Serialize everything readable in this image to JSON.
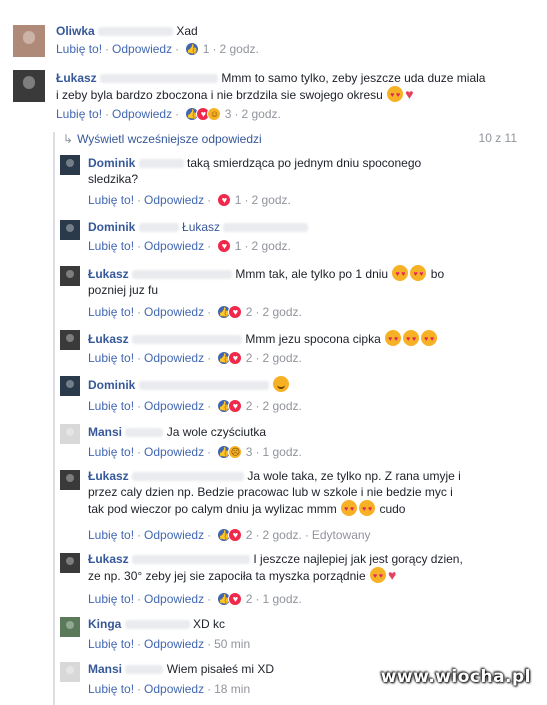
{
  "labels": {
    "like": "Lubię to!",
    "reply": "Odpowiedz",
    "edited": "Edytowany"
  },
  "view_more": {
    "label": "Wyświetl wcześniejsze odpowiedzi",
    "pager": "10 z 11"
  },
  "comments": [
    {
      "name": "Oliwka",
      "line1": "Xad",
      "line2": "",
      "count": "1",
      "time": "2 godz."
    },
    {
      "name": "Łukasz",
      "line1": "Mmm to samo tylko, zeby jeszcze uda duze miala",
      "line2": "i zeby byla bardzo zboczona i nie brzdzila sie swojego okresu",
      "count": "3",
      "time": "2 godz."
    },
    {
      "name": "Dominik",
      "line1": "taką smierdząca po jednym dniu spoconego",
      "line2": "sledzika?",
      "count": "1",
      "time": "2 godz."
    },
    {
      "name": "Dominik",
      "line1": "Łukasz",
      "line2": "",
      "count": "1",
      "time": "2 godz."
    },
    {
      "name": "Łukasz",
      "line1": "Mmm tak, ale tylko po 1 dniu",
      "line1b": "bo",
      "line2": "pozniej juz fu",
      "count": "2",
      "time": "2 godz."
    },
    {
      "name": "Łukasz",
      "line1": "Mmm jezu spocona cipka",
      "line2": "",
      "count": "2",
      "time": "2 godz."
    },
    {
      "name": "Dominik",
      "line1": "",
      "line2": "",
      "count": "2",
      "time": "2 godz."
    },
    {
      "name": "Mansi",
      "line1": "Ja wole czyściutka",
      "line2": "",
      "count": "3",
      "time": "1 godz."
    },
    {
      "name": "Łukasz",
      "line1": "Ja wole taka, ze tylko np. Z rana umyje i",
      "line2": "przez caly dzien np. Bedzie pracowac lub w szkole i nie bedzie myc i",
      "line3": "tak pod wieczor po calym dniu ja wylizac mmm",
      "line3b": "cudo",
      "count": "2",
      "time": "2 godz."
    },
    {
      "name": "Łukasz",
      "line1": "I jeszcze najlepiej jak jest gorący dzien,",
      "line2": "ze np. 30° zeby jej sie zapociła ta myszka porządnie",
      "count": "2",
      "time": "1 godz."
    },
    {
      "name": "Kinga",
      "line1": "XD kc",
      "line2": "",
      "count": "",
      "time": "50 min"
    },
    {
      "name": "Mansi",
      "line1": "Wiem pisałeś mi XD",
      "line2": "",
      "count": "",
      "time": "18 min"
    }
  ],
  "watermark": "www.wiocha.pl",
  "colors": {
    "link": "#4267b2",
    "name": "#365899",
    "meta": "#90949c"
  }
}
